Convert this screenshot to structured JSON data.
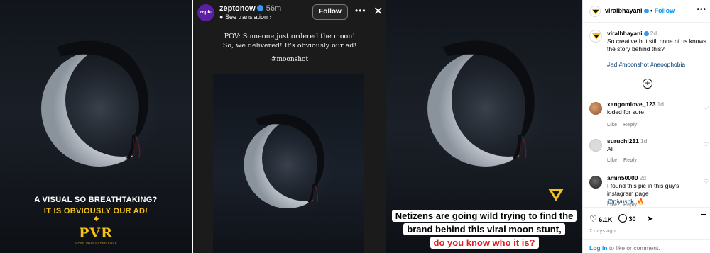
{
  "panel1": {
    "tagline_1": "A VISUAL SO BREATHTAKING?",
    "tagline_2": "IT IS OBVIOUSLY OUR AD!",
    "brand": "PVR",
    "brand_sub": "A PVR INOX EXPERIENCE"
  },
  "panel2": {
    "avatar_text": "zepto",
    "username": "zeptonow",
    "time": "56m",
    "see_translation": "See translation",
    "follow": "Follow",
    "caption_1": "POV: Someone just ordered the moon!",
    "caption_2": "So, we delivered! It's obviously our ad!",
    "hashtag": "#moonshot"
  },
  "panel3": {
    "banner_1": "Netizens are going wild trying to find the",
    "banner_2": "brand behind this viral moon stunt,",
    "banner_3": "do you know who it is?"
  },
  "sidebar": {
    "header_name": "viralbhayani",
    "follow": "Follow",
    "caption": {
      "username": "viralbhayani",
      "time": "2d",
      "text": "So creative but still none of us knows the story behind this?",
      "hashtags": "#ad #moonshot #neoophobia"
    },
    "comments": [
      {
        "username": "xangomlove_123",
        "time": "1d",
        "text": "loded for sure",
        "like": "Like",
        "reply": "Reply"
      },
      {
        "username": "suruchi231",
        "time": "1d",
        "text": "AI",
        "like": "Like",
        "reply": "Reply"
      },
      {
        "username": "amin50000",
        "time": "2d",
        "text": "I found this pic in this guy's instagram page",
        "mention": "@piyushk.",
        "emoji": "🔥",
        "like": "Like",
        "reply": "Reply"
      }
    ],
    "likes": "6.1K",
    "comments_count": "30",
    "ago": "2 days ago",
    "login_link": "Log in",
    "login_rest": " to like or comment."
  },
  "colors": {
    "brand_yellow": "#f2c21b",
    "ig_blue": "#0095f6",
    "red_text": "#e01e1e"
  }
}
